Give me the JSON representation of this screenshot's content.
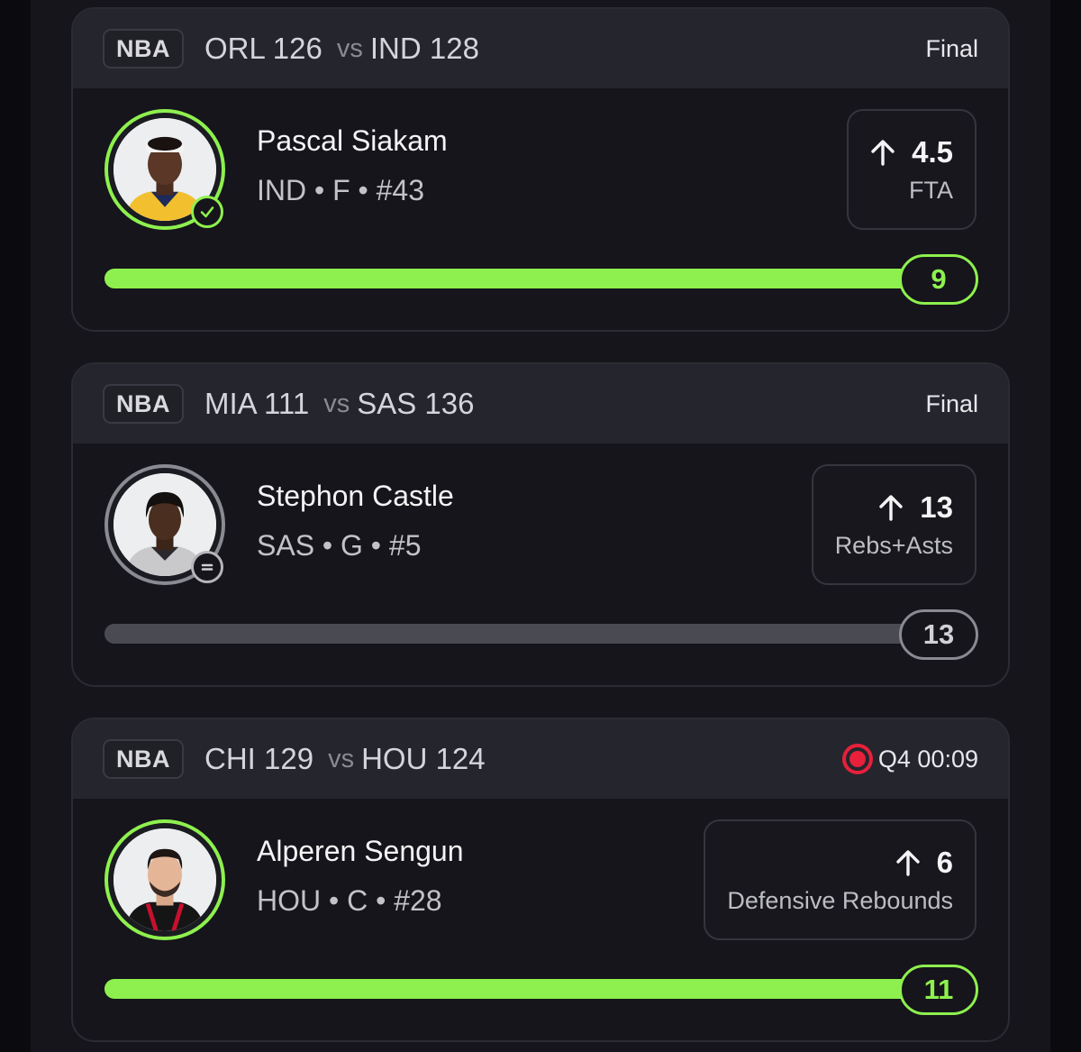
{
  "colors": {
    "accent_green": "#8ef04e",
    "live_red": "#e8203a",
    "neutral_grey": "#8a8a92"
  },
  "cards": [
    {
      "league": "NBA",
      "away_team": "ORL 126",
      "vs": "vs",
      "home_team": "IND 128",
      "status": "Final",
      "live": false,
      "player_name": "Pascal Siakam",
      "player_meta": "IND • F • #43",
      "prop_direction": "up-arrow-icon",
      "prop_line": "4.5",
      "prop_stat": "FTA",
      "result_value": "9",
      "progress": 1.0,
      "state": "hit",
      "badge_icon": "check-icon"
    },
    {
      "league": "NBA",
      "away_team": "MIA 111",
      "vs": "vs",
      "home_team": "SAS 136",
      "status": "Final",
      "live": false,
      "player_name": "Stephon Castle",
      "player_meta": "SAS • G • #5",
      "prop_direction": "up-arrow-icon",
      "prop_line": "13",
      "prop_stat": "Rebs+Asts",
      "result_value": "13",
      "progress": 1.0,
      "state": "push",
      "badge_icon": "equals-icon"
    },
    {
      "league": "NBA",
      "away_team": "CHI 129",
      "vs": "vs",
      "home_team": "HOU 124",
      "status": "Q4 00:09",
      "live": true,
      "player_name": "Alperen Sengun",
      "player_meta": "HOU • C • #28",
      "prop_direction": "up-arrow-icon",
      "prop_line": "6",
      "prop_stat": "Defensive Rebounds",
      "result_value": "11",
      "progress": 1.0,
      "state": "hit",
      "badge_icon": null
    }
  ]
}
